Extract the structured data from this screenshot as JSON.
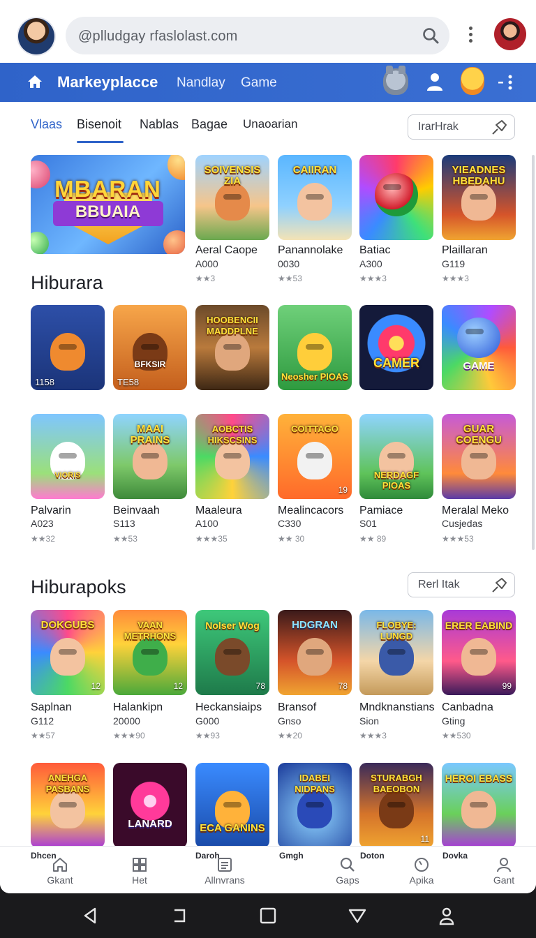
{
  "search": {
    "placeholder": "@plludgay rfaslolast.com"
  },
  "appbar": {
    "title": "Markeyplacce",
    "links": [
      "Nandlay",
      "Game"
    ]
  },
  "tabs": [
    "Vlaas",
    "Bisenoit",
    "Nablas",
    "Bagae",
    "Unaoarian"
  ],
  "filter": {
    "top_label": "IrarHrak",
    "mid_label": "Rerl Itak"
  },
  "banner": {
    "line1": "MBARAN",
    "line2": "BBUAIA"
  },
  "row1": [
    {
      "name": "Aeral Caope",
      "meta": "A000",
      "rating": "★★3",
      "art": "SOIVENSIS ZIA"
    },
    {
      "name": "Panannolake",
      "meta": "0030",
      "rating": "★★53",
      "art": "CAIIRAN"
    },
    {
      "name": "Batiac",
      "meta": "A300",
      "rating": "★★★3",
      "art": ""
    },
    {
      "name": "Plaillaran",
      "meta": "G119",
      "rating": "★★★3",
      "art": "YIEADNES HBEDAHU"
    }
  ],
  "sections": {
    "s1": "Hiburara",
    "s2": "Hiburapoks"
  },
  "row2": [
    {
      "art": "",
      "badge": "1158"
    },
    {
      "art": "BFKSIR",
      "badge": "TE58"
    },
    {
      "art": "HOOBENCII MADDPLNE",
      "badge": ""
    },
    {
      "art": "Neosher PIOAS",
      "badge": ""
    },
    {
      "art": "CAMER",
      "badge": ""
    },
    {
      "art": "GAME",
      "badge": ""
    }
  ],
  "row3": [
    {
      "name": "Palvarin",
      "meta": "A023",
      "rating": "★★32",
      "art": "VIORIS"
    },
    {
      "name": "Beinvaah",
      "meta": "S113",
      "rating": "★★53",
      "art": "MAAI PRAINS"
    },
    {
      "name": "Maaleura",
      "meta": "A100",
      "rating": "★★★35",
      "art": "AOBCTIS HIKSCSINS"
    },
    {
      "name": "Mealincacors",
      "meta": "C330",
      "rating": "★★ 30",
      "art": "COITTAGO",
      "num": "19"
    },
    {
      "name": "Pamiace",
      "meta": "S01",
      "rating": "★★ 89",
      "art": "NERDAGF PIOAS"
    },
    {
      "name": "Meralal Meko",
      "meta": "Cusjedas",
      "rating": "★★★53",
      "art": "GUAR COENGU"
    }
  ],
  "row4": [
    {
      "name": "Saplnan",
      "meta": "G112",
      "rating": "★★57",
      "art": "DOKGUBS",
      "num": "12"
    },
    {
      "name": "Halankipn",
      "meta": "20000",
      "rating": "★★★90",
      "art": "VAAN METRHONS",
      "num": "12"
    },
    {
      "name": "Heckansiaips",
      "meta": "G000",
      "rating": "★★93",
      "art": "Nolser Wog",
      "num": "78"
    },
    {
      "name": "Bransof",
      "meta": "Gnso",
      "rating": "★★20",
      "art": "HDGRAN",
      "num": "78"
    },
    {
      "name": "Mndknanstians",
      "meta": "Sion",
      "rating": "★★★3",
      "art": "FLOBYE: LUNGD"
    },
    {
      "name": "Canbadna",
      "meta": "Gting",
      "rating": "★★530",
      "art": "ERER EABIND",
      "num": "99"
    }
  ],
  "row5": [
    {
      "art": "ANEHGA PASBANS"
    },
    {
      "art": "LANARD"
    },
    {
      "art": "ECA GANINS"
    },
    {
      "art": "IDABEI NIDPANS"
    },
    {
      "art": "STURABGH BAEOBON",
      "num": "11"
    },
    {
      "art": "HEROI EBASS"
    }
  ],
  "bottom_nav": [
    {
      "top": "Dhcen",
      "label": "Gkant",
      "icon": "home-icon"
    },
    {
      "top": "",
      "label": "Het",
      "icon": "grid-icon"
    },
    {
      "top": "Daroh",
      "label": "Allnvrans",
      "icon": "list-icon"
    },
    {
      "top": "Gmgh",
      "label": "Gaps",
      "icon": "search-icon"
    },
    {
      "top": "Doton",
      "label": "Apika",
      "icon": "clock-icon"
    },
    {
      "top": "Dovka",
      "label": "Gant",
      "icon": "person-icon"
    }
  ],
  "colors": {
    "brand": "#2f63c9",
    "text": "#202227",
    "muted": "#8a8d94"
  }
}
